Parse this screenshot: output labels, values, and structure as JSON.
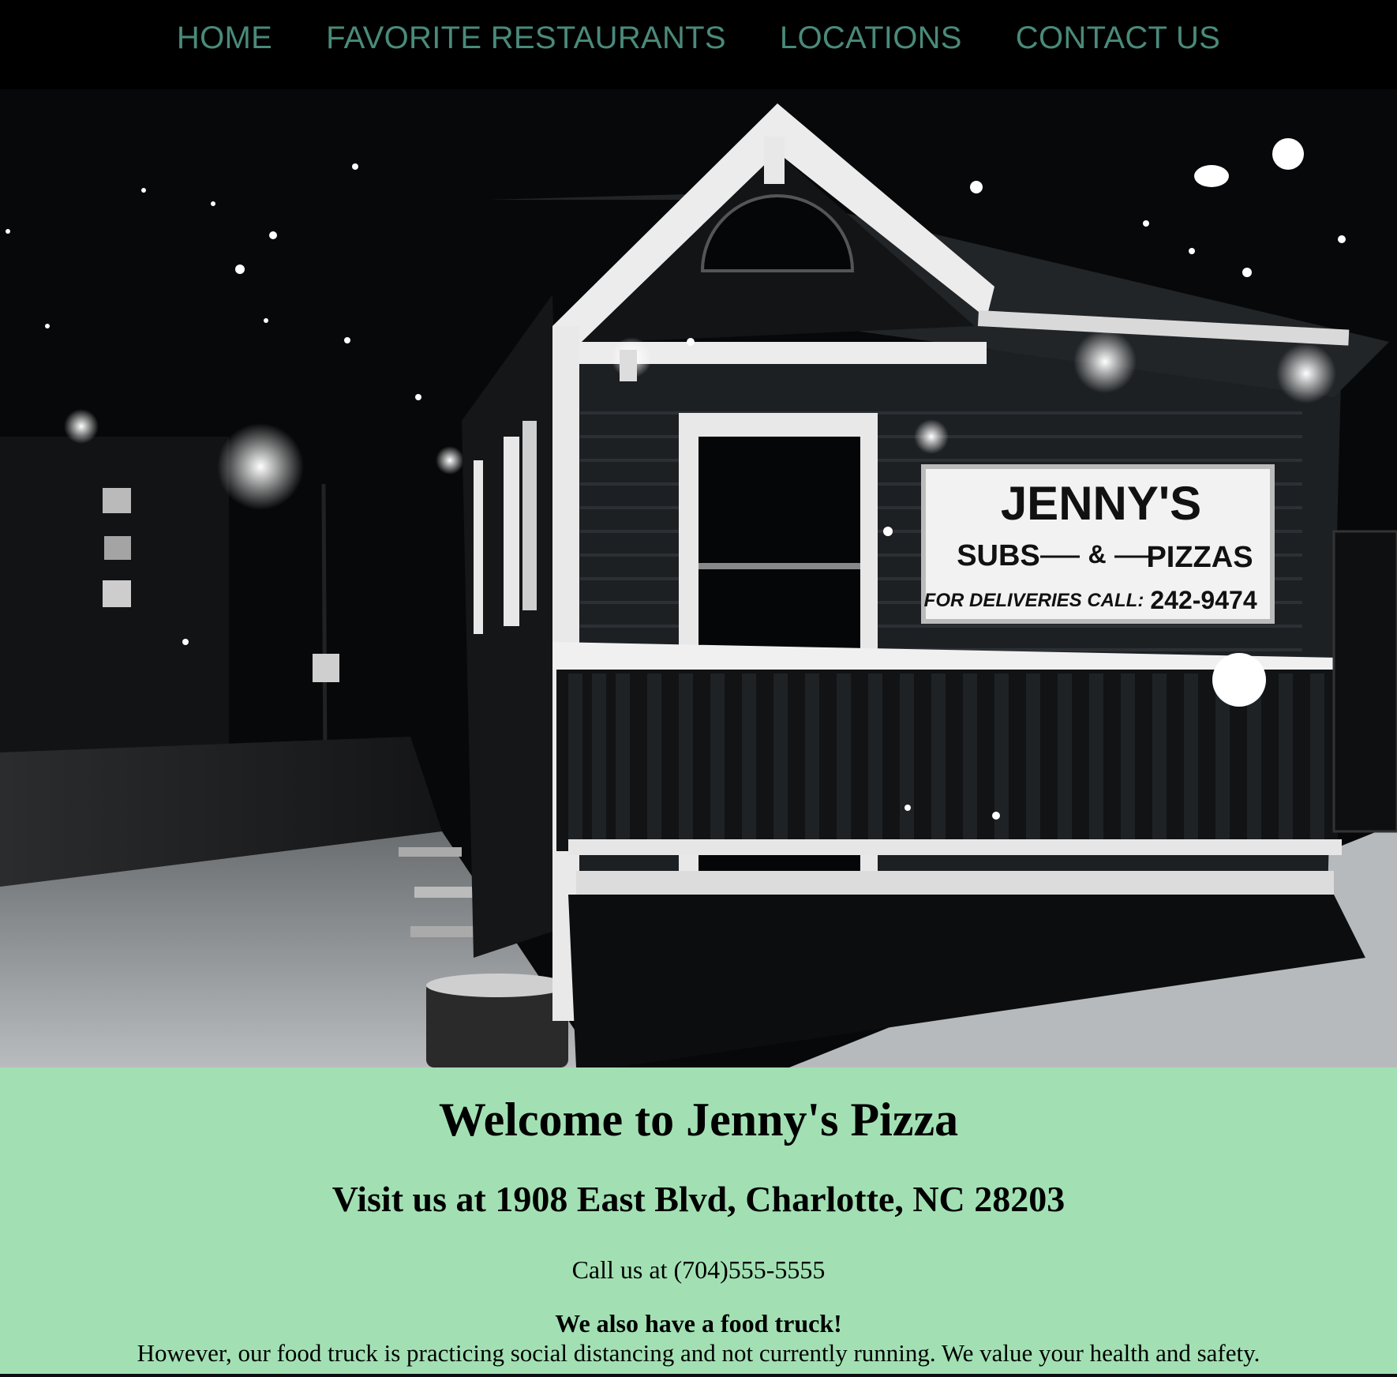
{
  "nav": {
    "items": [
      {
        "label": "HOME"
      },
      {
        "label": "FAVORITE RESTAURANTS"
      },
      {
        "label": "LOCATIONS"
      },
      {
        "label": "CONTACT US"
      }
    ],
    "color": "#4a8a7a"
  },
  "hero": {
    "sign": {
      "name": "JENNY'S",
      "subs": "SUBS",
      "amp": "&",
      "pizzas": "PIZZAS",
      "delivery": "FOR DELIVERIES CALL:",
      "phone": "242-9474"
    }
  },
  "welcome": {
    "title": "Welcome to Jenny's Pizza",
    "address": "Visit us at 1908 East Blvd, Charlotte, NC 28203",
    "phone": "Call us at (704)555-5555",
    "truck_title": "We also have a food truck!",
    "truck_note": "However, our food truck is practicing social distancing and not currently running. We value your health and safety.",
    "background": "#a2e0b3"
  }
}
